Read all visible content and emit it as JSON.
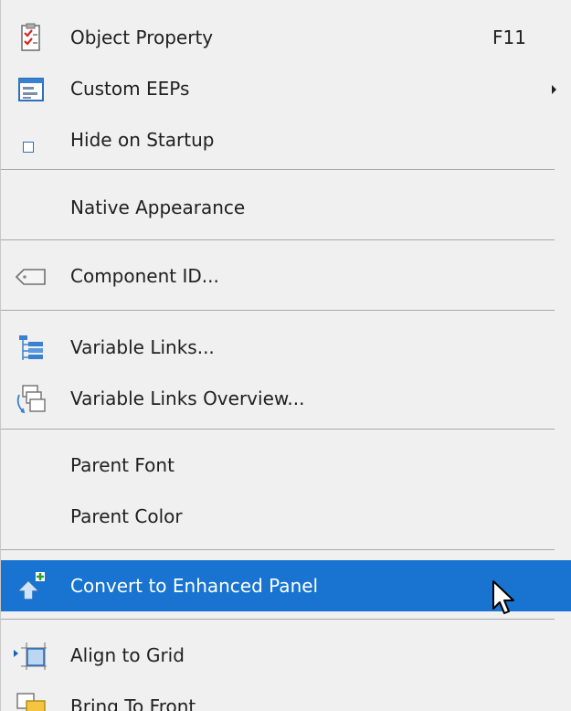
{
  "menu": {
    "items": [
      {
        "label": "Object Property",
        "shortcut": "F11"
      },
      {
        "label": "Custom EEPs"
      },
      {
        "label": "Hide on Startup"
      },
      {
        "label": "Native Appearance"
      },
      {
        "label": "Component ID..."
      },
      {
        "label": "Variable Links..."
      },
      {
        "label": "Variable Links Overview..."
      },
      {
        "label": "Parent Font"
      },
      {
        "label": "Parent Color"
      },
      {
        "label": "Convert to Enhanced Panel"
      },
      {
        "label": "Align to Grid"
      },
      {
        "label": "Bring To Front"
      }
    ],
    "icons": {
      "object_property": "clipboard-checklist-icon",
      "custom_eeps": "window-form-icon",
      "component_id": "tag-icon",
      "variable_links": "tree-list-icon",
      "variable_links_overview": "linked-windows-icon",
      "convert_to_enhanced_panel": "arrow-up-plus-icon",
      "align_to_grid": "align-grid-icon",
      "bring_to_front": "bring-to-front-icon"
    },
    "highlighted_item": "Convert to Enhanced Panel",
    "hide_on_startup_checked": false
  },
  "colors": {
    "menu_background": "#f0f0f0",
    "highlight": "#1874d0",
    "text": "#202020",
    "separator": "#a8a8a8"
  }
}
